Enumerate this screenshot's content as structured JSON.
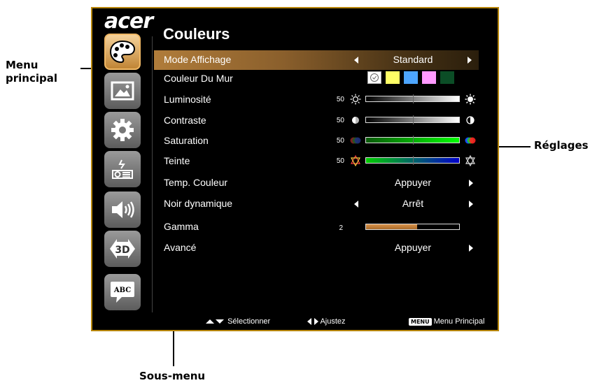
{
  "callouts": {
    "main_menu_line1": "Menu",
    "main_menu_line2": "principal",
    "settings": "Réglages",
    "submenu": "Sous-menu"
  },
  "osd": {
    "logo": "acer",
    "title": "Couleurs",
    "menu_icons": [
      "palette-icon",
      "image-icon",
      "gear-icon",
      "projector-icon",
      "speaker-icon",
      "3d-icon",
      "speech-bubble-abc-icon"
    ],
    "bubble_text": "ABC",
    "three_d_text": "3D",
    "rows": {
      "display_mode": {
        "label": "Mode Affichage",
        "value": "Standard"
      },
      "wall_color": {
        "label": "Couleur Du Mur",
        "swatches": [
          "#ffffff",
          "#ffff66",
          "#4da6ff",
          "#ff99ff",
          "#0b4d26"
        ]
      },
      "brightness": {
        "label": "Luminosité",
        "value": "50",
        "level": 50
      },
      "contrast": {
        "label": "Contraste",
        "value": "50",
        "level": 50
      },
      "saturation": {
        "label": "Saturation",
        "value": "50",
        "level": 50
      },
      "tint": {
        "label": "Teinte",
        "value": "50",
        "level": 50
      },
      "color_temp": {
        "label": "Temp. Couleur",
        "value": "Appuyer"
      },
      "dynamic_black": {
        "label": "Noir dynamique",
        "value": "Arrêt"
      },
      "gamma": {
        "label": "Gamma",
        "value": "2",
        "level": 55
      },
      "advanced": {
        "label": "Avancé",
        "value": "Appuyer"
      }
    },
    "footer": {
      "select": "Sélectionner",
      "adjust": "Ajustez",
      "menu_key": "MENU",
      "main_menu": "Menu Principal"
    },
    "colors": {
      "frame": "#b8860b",
      "highlight": "#b07c3a",
      "gamma_fill": "#d9934a"
    }
  }
}
